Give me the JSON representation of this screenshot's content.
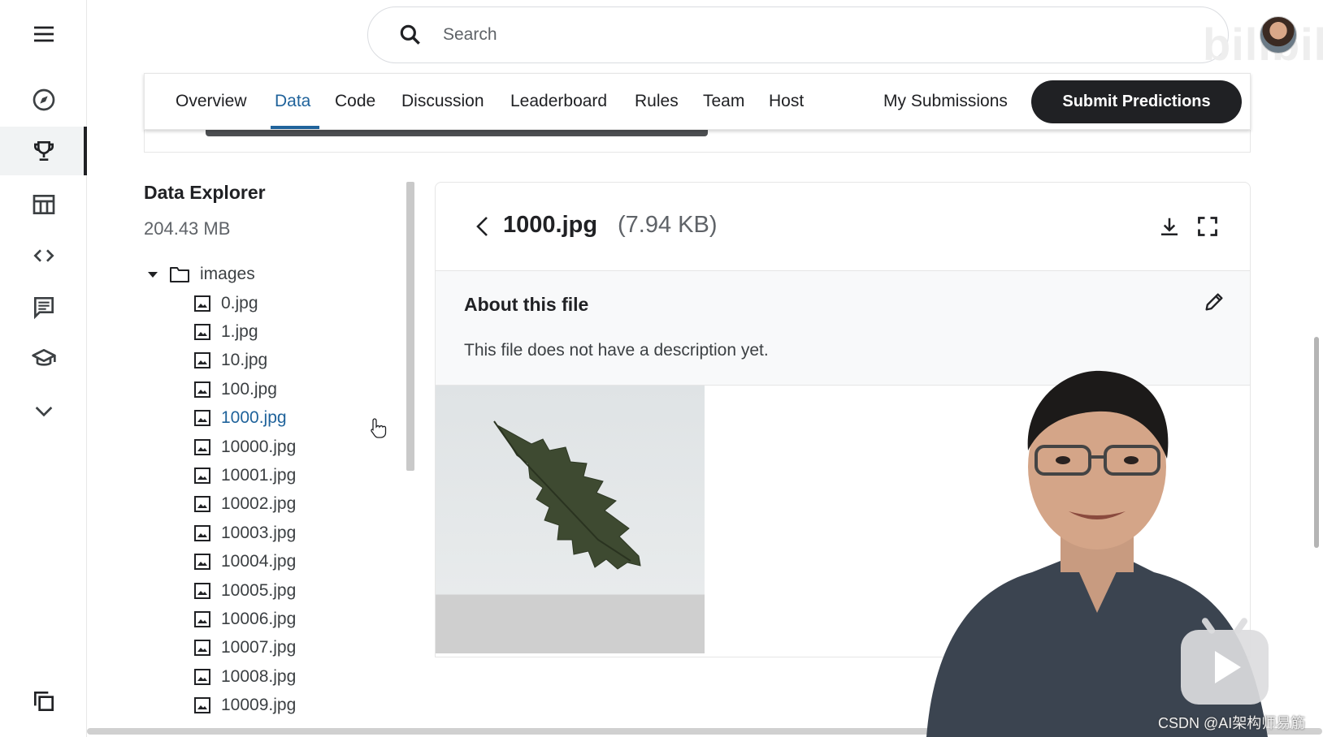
{
  "search": {
    "placeholder": "Search"
  },
  "watermark": "bilibili",
  "sidebar": {
    "items": [
      {
        "icon": "menu-icon"
      },
      {
        "icon": "compass-icon"
      },
      {
        "icon": "trophy-icon",
        "active": true
      },
      {
        "icon": "table-icon"
      },
      {
        "icon": "code-icon"
      },
      {
        "icon": "comment-icon"
      },
      {
        "icon": "school-icon"
      },
      {
        "icon": "chevron-down-icon"
      },
      {
        "icon": "copy-icon"
      }
    ]
  },
  "tabs": [
    {
      "label": "Overview"
    },
    {
      "label": "Data",
      "active": true
    },
    {
      "label": "Code"
    },
    {
      "label": "Discussion"
    },
    {
      "label": "Leaderboard"
    },
    {
      "label": "Rules"
    },
    {
      "label": "Team"
    },
    {
      "label": "Host"
    }
  ],
  "header_actions": {
    "my_submissions": "My Submissions",
    "submit": "Submit Predictions"
  },
  "explorer": {
    "title": "Data Explorer",
    "size": "204.43 MB",
    "folder": "images",
    "files": [
      "0.jpg",
      "1.jpg",
      "10.jpg",
      "100.jpg",
      "1000.jpg",
      "10000.jpg",
      "10001.jpg",
      "10002.jpg",
      "10003.jpg",
      "10004.jpg",
      "10005.jpg",
      "10006.jpg",
      "10007.jpg",
      "10008.jpg",
      "10009.jpg"
    ],
    "selected": "1000.jpg"
  },
  "file_panel": {
    "name": "1000.jpg",
    "size": "(7.94 KB)",
    "about_title": "About this file",
    "description": "This file does not have a description yet."
  },
  "overlay": {
    "credit": "CSDN @AI架构师易筋"
  },
  "colors": {
    "accent": "#20639b",
    "dark_button": "#202124"
  }
}
